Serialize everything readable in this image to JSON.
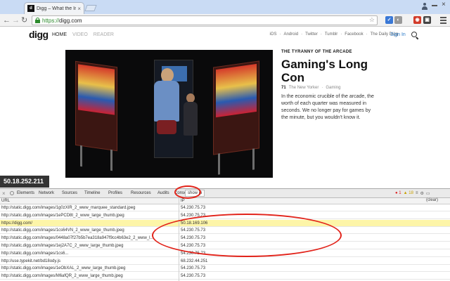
{
  "browser": {
    "tab_title": "Digg – What the Internet…",
    "tab_favicon": "digg",
    "url_scheme": "https://",
    "url_host": "digg.com",
    "extensions": [
      {
        "name": "translate-icon",
        "glyph": "✓",
        "color": "#3a78d6"
      },
      {
        "name": "pocket-icon",
        "glyph": "◐",
        "color": "#999999"
      },
      {
        "name": "red-extension-icon",
        "glyph": "◉",
        "color": "#d23b2a"
      },
      {
        "name": "dark-extension-icon",
        "glyph": "▣",
        "color": "#444444"
      }
    ]
  },
  "site": {
    "logo": "digg",
    "nav": [
      "HOME",
      "VIDEO",
      "READER"
    ],
    "links": [
      "iOS",
      "·",
      "Android",
      "·",
      "Twitter",
      "·",
      "Tumblr",
      "·",
      "Facebook",
      "·",
      "The Daily Digg"
    ],
    "signin": "Sign In"
  },
  "article": {
    "kicker": "THE TYRANNY OF THE ARCADE",
    "headline": "Gaming's Long Con",
    "diggs": "71",
    "source": "The New Yorker",
    "category": "Gaming",
    "summary": "In the economic crucible of the arcade, the worth of each quarter was measured in seconds. We no longer pay for games by the minute, but you wouldn't know it."
  },
  "ip_badge": "50.18.252.211",
  "devtools": {
    "tabs": [
      "Elements",
      "Network",
      "Sources",
      "Timeline",
      "Profiles",
      "Resources",
      "Audits",
      "Conso",
      "show ip"
    ],
    "active_tab": "show ip",
    "errors": "1",
    "warnings": "18",
    "header_url": "URL",
    "header_ip": "IP",
    "clear_label": "(clear)",
    "rows": [
      {
        "url": "http://static.digg.com/images/1g0zXIR_2_www_marquee_standard.jpeg",
        "ip": "54.230.75.73"
      },
      {
        "url": "http://static.digg.com/images/1ePCD8t_2_www_large_thumb.jpeg",
        "ip": "54.230.75.73"
      },
      {
        "url": "https://digg.com/",
        "ip": "50.18.169.106"
      },
      {
        "url": "http://static.digg.com/images/1cs64VN_2_www_large_thumb.jpeg",
        "ip": "54.230.75.73"
      },
      {
        "url": "http://static.digg.com/images/0448a07f27b5b7ea318a947f9cc4b63e2_2_www_l...",
        "ip": "54.230.75.73"
      },
      {
        "url": "http://static.digg.com/images/1ej2A7C_2_www_large_thumb.jpeg",
        "ip": "54.230.75.73"
      },
      {
        "url": "http://static.digg.com/images/1cs6...",
        "ip": "54.230.75.73"
      },
      {
        "url": "http://use.typekit.net/bd18ody.js",
        "ip": "68.232.44.251"
      },
      {
        "url": "http://static.digg.com/images/1eObXAL_2_www_large_thumb.jpeg",
        "ip": "54.230.75.73"
      },
      {
        "url": "http://static.digg.com/images/M6afQR_2_www_large_thumb.jpeg",
        "ip": "54.230.75.73"
      }
    ]
  },
  "colors": {
    "highlight_row": "#fdf5a8",
    "annotation": "#e2231a",
    "link": "#2a7ac9"
  }
}
